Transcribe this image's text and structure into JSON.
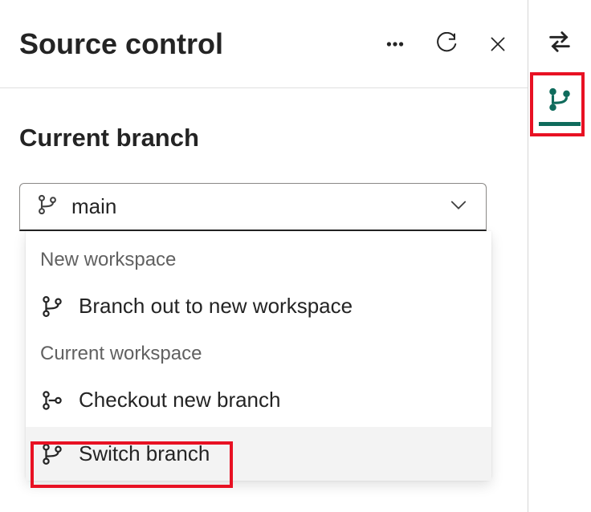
{
  "header": {
    "title": "Source control"
  },
  "section": {
    "title": "Current branch"
  },
  "select": {
    "value": "main"
  },
  "dropdown": {
    "groups": [
      {
        "label": "New workspace",
        "items": [
          {
            "icon": "branch-icon",
            "text": "Branch out to new workspace"
          }
        ]
      },
      {
        "label": "Current workspace",
        "items": [
          {
            "icon": "checkout-icon",
            "text": "Checkout new branch"
          },
          {
            "icon": "branch-icon",
            "text": "Switch branch"
          }
        ]
      }
    ]
  },
  "colors": {
    "accent": "#0f6b5c",
    "highlight": "#e81123"
  }
}
